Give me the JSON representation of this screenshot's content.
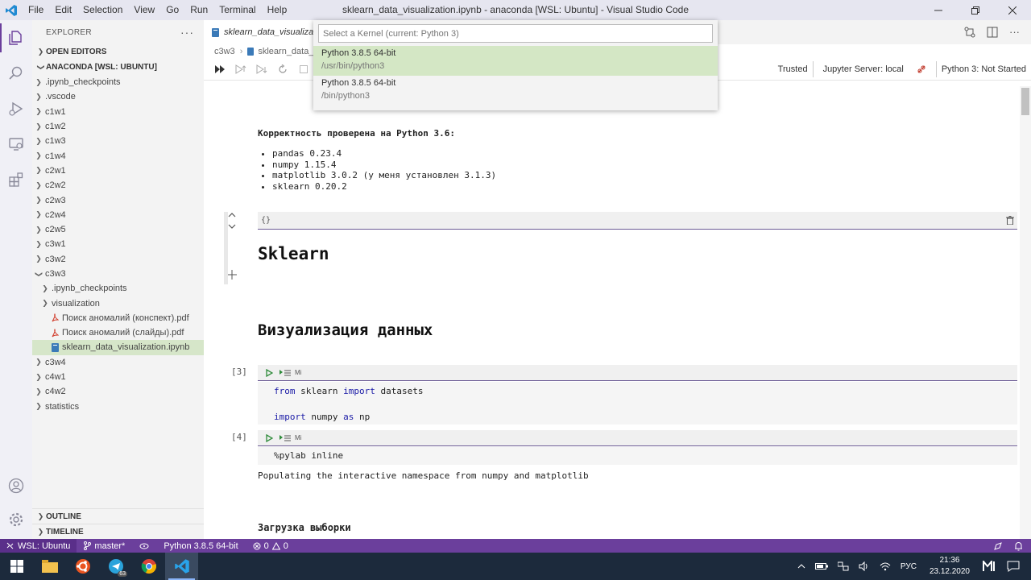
{
  "window": {
    "title": "sklearn_data_visualization.ipynb - anaconda [WSL: Ubuntu] - Visual Studio Code",
    "menu": [
      "File",
      "Edit",
      "Selection",
      "View",
      "Go",
      "Run",
      "Terminal",
      "Help"
    ]
  },
  "sidebar": {
    "header": "EXPLORER",
    "open_editors": "OPEN EDITORS",
    "workspace": "ANACONDA [WSL: UBUNTU]",
    "tree": [
      {
        "label": ".ipynb_checkpoints",
        "depth": 1,
        "type": "folder",
        "expanded": false
      },
      {
        "label": ".vscode",
        "depth": 1,
        "type": "folder",
        "expanded": false
      },
      {
        "label": "c1w1",
        "depth": 1,
        "type": "folder",
        "expanded": false
      },
      {
        "label": "c1w2",
        "depth": 1,
        "type": "folder",
        "expanded": false
      },
      {
        "label": "c1w3",
        "depth": 1,
        "type": "folder",
        "expanded": false
      },
      {
        "label": "c1w4",
        "depth": 1,
        "type": "folder",
        "expanded": false
      },
      {
        "label": "c2w1",
        "depth": 1,
        "type": "folder",
        "expanded": false
      },
      {
        "label": "c2w2",
        "depth": 1,
        "type": "folder",
        "expanded": false
      },
      {
        "label": "c2w3",
        "depth": 1,
        "type": "folder",
        "expanded": false
      },
      {
        "label": "c2w4",
        "depth": 1,
        "type": "folder",
        "expanded": false
      },
      {
        "label": "c2w5",
        "depth": 1,
        "type": "folder",
        "expanded": false
      },
      {
        "label": "c3w1",
        "depth": 1,
        "type": "folder",
        "expanded": false
      },
      {
        "label": "c3w2",
        "depth": 1,
        "type": "folder",
        "expanded": false
      },
      {
        "label": "c3w3",
        "depth": 1,
        "type": "folder",
        "expanded": true
      },
      {
        "label": ".ipynb_checkpoints",
        "depth": 2,
        "type": "folder",
        "expanded": false
      },
      {
        "label": "visualization",
        "depth": 2,
        "type": "folder",
        "expanded": false
      },
      {
        "label": "Поиск аномалий (конспект).pdf",
        "depth": 2,
        "type": "pdf"
      },
      {
        "label": "Поиск аномалий (слайды).pdf",
        "depth": 2,
        "type": "pdf"
      },
      {
        "label": "sklearn_data_visualization.ipynb",
        "depth": 2,
        "type": "notebook",
        "selected": true
      },
      {
        "label": "c3w4",
        "depth": 1,
        "type": "folder",
        "expanded": false
      },
      {
        "label": "c4w1",
        "depth": 1,
        "type": "folder",
        "expanded": false
      },
      {
        "label": "c4w2",
        "depth": 1,
        "type": "folder",
        "expanded": false
      },
      {
        "label": "statistics",
        "depth": 1,
        "type": "folder",
        "expanded": false
      }
    ],
    "outline": "OUTLINE",
    "timeline": "TIMELINE"
  },
  "editor": {
    "tab_label": "sklearn_data_visualiza",
    "breadcrumb": [
      "c3w3",
      "sklearn_data_v"
    ],
    "status": {
      "trusted": "Trusted",
      "server": "Jupyter Server: local",
      "kernel": "Python 3: Not Started"
    }
  },
  "kernel_picker": {
    "placeholder": "Select a Kernel (current: Python 3)",
    "items": [
      {
        "name": "Python 3.8.5 64-bit",
        "path": "/usr/bin/python3",
        "selected": true
      },
      {
        "name": "Python 3.8.5 64-bit",
        "path": "/bin/python3",
        "selected": false
      }
    ]
  },
  "notebook": {
    "checked_heading": "Корректность проверена на Python 3.6:",
    "versions": [
      "pandas 0.23.4",
      "numpy 1.15.4",
      "matplotlib 3.0.2 (у меня установлен 3.1.3)",
      "sklearn 0.20.2"
    ],
    "md_cell_badge": "{}",
    "heading_sklearn": "Sklearn",
    "heading_viz": "Визуализация данных",
    "cell3": {
      "count": "[3]",
      "mi": "Mi",
      "line1": {
        "k1": "from",
        "t1": " sklearn ",
        "k2": "import",
        "t2": " datasets"
      },
      "line2": {
        "k1": "import",
        "t1": " numpy ",
        "k2": "as",
        "t2": " np"
      }
    },
    "cell4": {
      "count": "[4]",
      "mi": "Mi",
      "code": "%pylab inline",
      "output": "Populating the interactive namespace from numpy and matplotlib"
    },
    "heading_load": "Загрузка выборки"
  },
  "statusbar": {
    "remote": "WSL: Ubuntu",
    "branch": "master*",
    "interpreter": "Python 3.8.5 64-bit",
    "errors": "0",
    "warnings": "0"
  },
  "taskbar": {
    "telegram_badge": "63",
    "language": "РУС",
    "time": "21:36",
    "date": "23.12.2020"
  },
  "colors": {
    "statusbar": "#6b3f9c",
    "selection": "#d6e6c9",
    "keyword": "#1a1aa6"
  }
}
